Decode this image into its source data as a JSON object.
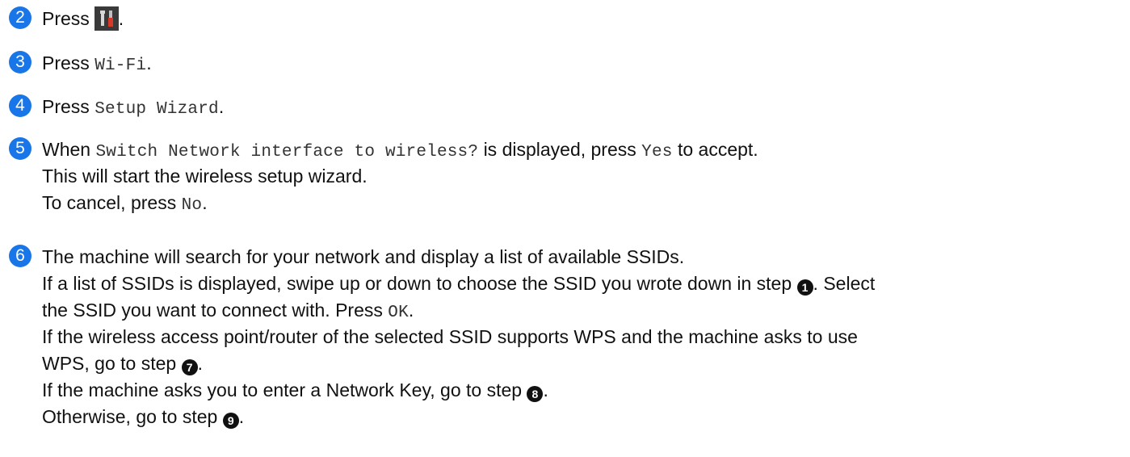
{
  "step2": {
    "num": "2",
    "text": "Press",
    "icon": "settings-tools-icon",
    "end": "."
  },
  "step3": {
    "num": "3",
    "text": "Press",
    "mono": "Wi-Fi",
    "end": "."
  },
  "step4": {
    "num": "4",
    "text": "Press",
    "mono": "Setup Wizard",
    "end": "."
  },
  "step5": {
    "num": "5",
    "l1a": "When",
    "l1b": "Switch Network interface to wireless?",
    "l1c": "is displayed, press",
    "l1d": "Yes",
    "l1e": "to accept.",
    "l2": "This will start the wireless setup wizard.",
    "l3a": "To cancel, press",
    "l3b": "No",
    "l3c": "."
  },
  "step6": {
    "num": "6",
    "l1": "The machine will search for your network and display a list of available SSIDs.",
    "l2a": "If a list of SSIDs is displayed, swipe up or down to choose the SSID you wrote down in step",
    "l2ref": "1",
    "l2b": ". Select",
    "l3a": "the SSID you want to connect with. Press",
    "l3b": "OK",
    "l3c": ".",
    "l4": "If the wireless access point/router of the selected SSID supports WPS and the machine asks to use",
    "l5a": "WPS, go to step",
    "l5ref": "7",
    "l5b": ".",
    "l6a": "If the machine asks you to enter a Network Key, go to step",
    "l6ref": "8",
    "l6b": ".",
    "l7a": "Otherwise, go to step",
    "l7ref": "9",
    "l7b": "."
  },
  "colors": {
    "step_badge": "#1976e8",
    "text": "#111111"
  }
}
